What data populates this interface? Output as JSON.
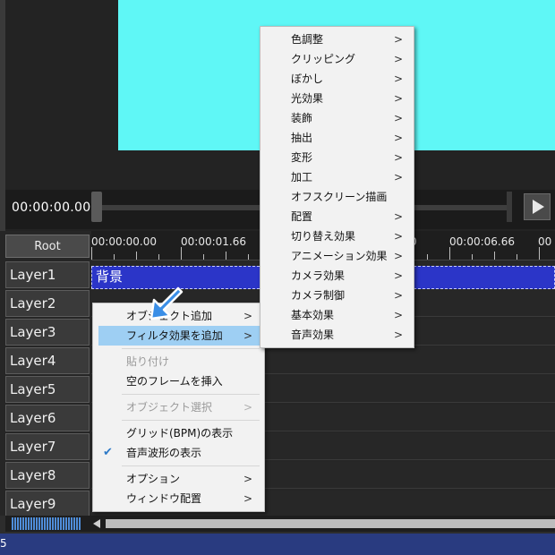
{
  "preview": {
    "timecode": "00:00:00.00",
    "canvas_color": "#5ff7f6"
  },
  "timeline": {
    "root_label": "Root",
    "ruler_labels": [
      "00:00:00.00",
      "00:00:01.66",
      "0",
      "00:00:06.66",
      "00"
    ],
    "layers": [
      "Layer1",
      "Layer2",
      "Layer3",
      "Layer4",
      "Layer5",
      "Layer6",
      "Layer7",
      "Layer8",
      "Layer9"
    ],
    "clip": {
      "label": "背景",
      "color": "#2b35c8"
    }
  },
  "context_menu": {
    "items": [
      {
        "label": "オブジェクト追加",
        "submenu": true,
        "disabled": false
      },
      {
        "label": "フィルタ効果を追加",
        "submenu": true,
        "disabled": false,
        "highlighted": true
      },
      {
        "label": "貼り付け",
        "submenu": false,
        "disabled": true
      },
      {
        "label": "空のフレームを挿入",
        "submenu": false,
        "disabled": false
      },
      {
        "label": "オブジェクト選択",
        "submenu": true,
        "disabled": true
      },
      {
        "label": "グリッド(BPM)の表示",
        "submenu": false,
        "disabled": false
      },
      {
        "label": "音声波形の表示",
        "submenu": false,
        "disabled": false,
        "checked": true
      },
      {
        "label": "オプション",
        "submenu": true,
        "disabled": false
      },
      {
        "label": "ウィンドウ配置",
        "submenu": true,
        "disabled": false
      }
    ]
  },
  "filter_menu": {
    "items": [
      {
        "label": "色調整",
        "submenu": true
      },
      {
        "label": "クリッピング",
        "submenu": true
      },
      {
        "label": "ぼかし",
        "submenu": true
      },
      {
        "label": "光効果",
        "submenu": true
      },
      {
        "label": "装飾",
        "submenu": true
      },
      {
        "label": "抽出",
        "submenu": true
      },
      {
        "label": "変形",
        "submenu": true
      },
      {
        "label": "加工",
        "submenu": true
      },
      {
        "label": "オフスクリーン描画",
        "submenu": false
      },
      {
        "label": "配置",
        "submenu": true
      },
      {
        "label": "切り替え効果",
        "submenu": true
      },
      {
        "label": "アニメーション効果",
        "submenu": true
      },
      {
        "label": "カメラ効果",
        "submenu": true
      },
      {
        "label": "カメラ制御",
        "submenu": true
      },
      {
        "label": "基本効果",
        "submenu": true
      },
      {
        "label": "音声効果",
        "submenu": true
      }
    ]
  },
  "status_bar": {
    "text": "5"
  },
  "icons": {
    "play": "play-icon",
    "submenu_arrow": "chevron-right-icon",
    "check": "check-icon",
    "cursor": "pointer-arrow-icon"
  },
  "colors": {
    "menu_highlight": "#9ecff3",
    "status_bar": "#293b80",
    "cursor": "#3a8ee6"
  }
}
